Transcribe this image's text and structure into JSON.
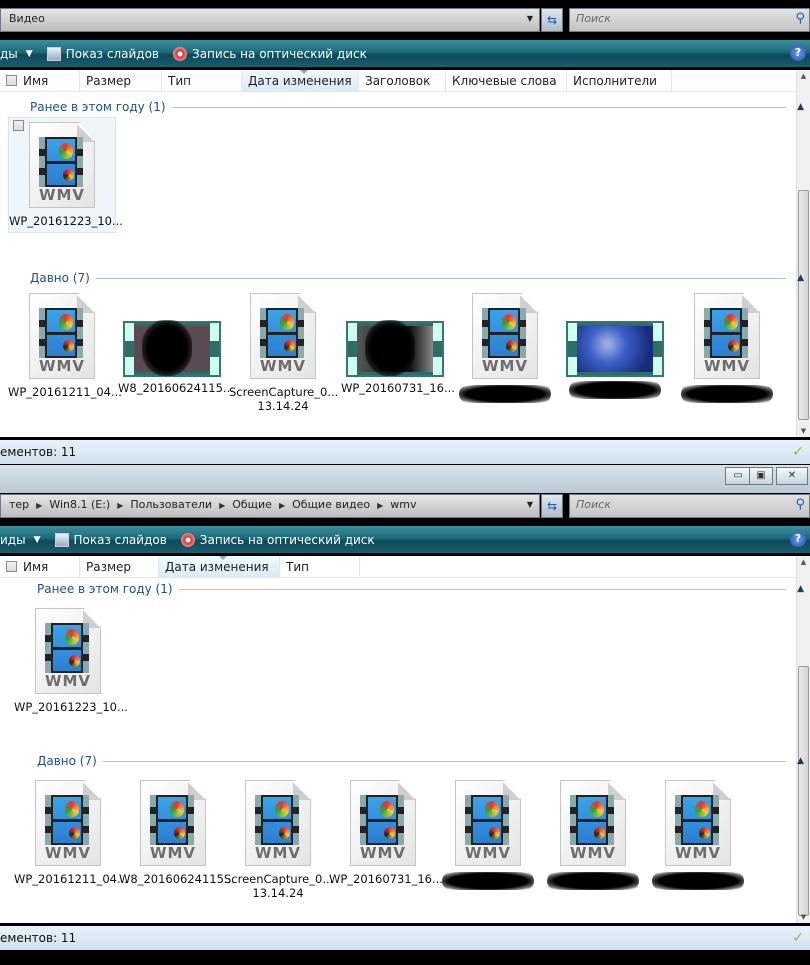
{
  "windows": [
    {
      "address": {
        "crumbs": [
          "Видео"
        ]
      },
      "search_placeholder": "Поиск",
      "toolbar": {
        "views": "ды",
        "slideshow": "Показ слайдов",
        "burn": "Запись на оптический диск"
      },
      "columns": [
        {
          "label": "Имя",
          "w": 80
        },
        {
          "label": "Размер",
          "w": 82
        },
        {
          "label": "Тип",
          "w": 80
        },
        {
          "label": "Дата изменения",
          "w": 117,
          "sorted": true
        },
        {
          "label": "Заголовок",
          "w": 87
        },
        {
          "label": "Ключевые слова",
          "w": 121
        },
        {
          "label": "Исполнители",
          "w": 105
        }
      ],
      "groups": [
        {
          "title": "Ранее в этом году (1)",
          "items": [
            {
              "kind": "wmv",
              "name": "WP_20161223_10...",
              "selected": true
            }
          ]
        },
        {
          "title": "Давно (7)",
          "items": [
            {
              "kind": "wmv",
              "name": "WP_20161211_04..."
            },
            {
              "kind": "thumb",
              "style": "",
              "name": "W8_20160624115..."
            },
            {
              "kind": "wmv",
              "name": "ScreenCapture_0...",
              "name2": "13.14.24"
            },
            {
              "kind": "thumb",
              "style": "dark",
              "name": "WP_20160731_16..."
            },
            {
              "kind": "wmv",
              "redacted": true
            },
            {
              "kind": "thumb",
              "style": "blue",
              "redacted": true
            },
            {
              "kind": "wmv",
              "redacted": true
            }
          ]
        }
      ],
      "status": "ементов: 11"
    },
    {
      "window_controls": {
        "minimize": "▭",
        "maximize": "▣",
        "close": "✕"
      },
      "address": {
        "crumbs": [
          "тер",
          "Win8.1 (E:)",
          "Пользователи",
          "Общие",
          "Общие видео",
          "wmv"
        ]
      },
      "search_placeholder": "Поиск",
      "toolbar": {
        "views": "иды",
        "slideshow": "Показ слайдов",
        "burn": "Запись на оптический диск"
      },
      "columns": [
        {
          "label": "Имя",
          "w": 80
        },
        {
          "label": "Размер",
          "w": 79
        },
        {
          "label": "Дата изменения",
          "w": 121,
          "sorted": true
        },
        {
          "label": "Тип",
          "w": 80
        }
      ],
      "groups": [
        {
          "title": "Ранее в этом году (1)",
          "items": [
            {
              "kind": "wmv",
              "name": "WP_20161223_10..."
            }
          ]
        },
        {
          "title": "Давно (7)",
          "items": [
            {
              "kind": "wmv",
              "name": "WP_20161211_04..."
            },
            {
              "kind": "wmv",
              "name": "W8_20160624115..."
            },
            {
              "kind": "wmv",
              "name": "ScreenCapture_0...",
              "name2": "13.14.24"
            },
            {
              "kind": "wmv",
              "name": "WP_20160731_16..."
            },
            {
              "kind": "wmv",
              "redacted": true
            },
            {
              "kind": "wmv",
              "redacted": true
            },
            {
              "kind": "wmv",
              "redacted": true
            }
          ]
        }
      ],
      "status": "ементов: 11"
    }
  ],
  "icon_ext": "WMV",
  "colors": {
    "toolbar": "#1d6a7a",
    "group_text": "#1e4e8c"
  }
}
